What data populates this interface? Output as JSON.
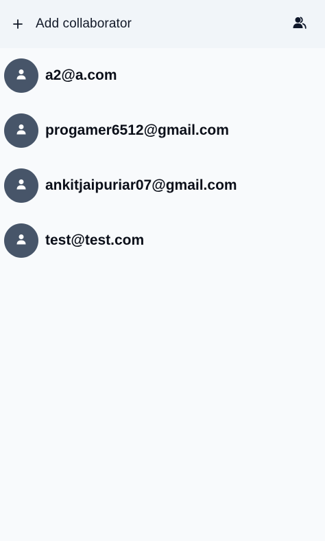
{
  "header": {
    "add_label": "Add collaborator",
    "add_icon": "plus-icon",
    "users_icon": "users-icon"
  },
  "collaborators": [
    {
      "email": "a2@a.com",
      "icon": "user-icon"
    },
    {
      "email": "progamer6512@gmail.com",
      "icon": "user-icon"
    },
    {
      "email": "ankitjaipuriar07@gmail.com",
      "icon": "user-icon"
    },
    {
      "email": "test@test.com",
      "icon": "user-icon"
    }
  ],
  "colors": {
    "header_bg": "#f1f5f9",
    "page_bg": "#f8fafc",
    "avatar_bg": "#475569"
  }
}
